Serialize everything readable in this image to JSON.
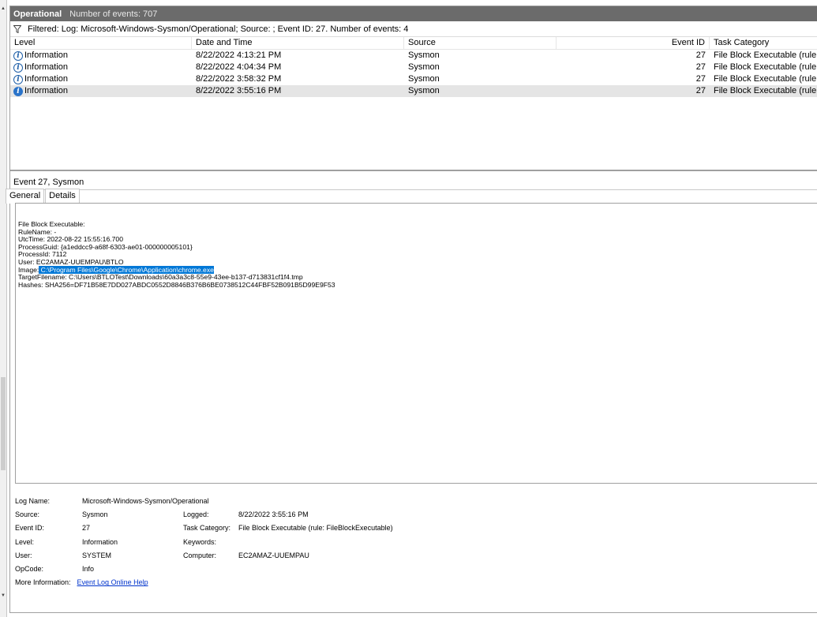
{
  "header": {
    "log_name": "Operational",
    "event_count": "Number of events: 707"
  },
  "filter": {
    "text": "Filtered: Log: Microsoft-Windows-Sysmon/Operational; Source: ; Event ID: 27. Number of events: 4"
  },
  "columns": {
    "level": "Level",
    "date": "Date and Time",
    "source": "Source",
    "eventid": "Event ID",
    "task": "Task Category"
  },
  "rows": [
    {
      "level": "Information",
      "date": "8/22/2022 4:13:21 PM",
      "source": "Sysmon",
      "eventid": "27",
      "task": "File Block Executable (rule: File"
    },
    {
      "level": "Information",
      "date": "8/22/2022 4:04:34 PM",
      "source": "Sysmon",
      "eventid": "27",
      "task": "File Block Executable (rule: File"
    },
    {
      "level": "Information",
      "date": "8/22/2022 3:58:32 PM",
      "source": "Sysmon",
      "eventid": "27",
      "task": "File Block Executable (rule: File"
    },
    {
      "level": "Information",
      "date": "8/22/2022 3:55:16 PM",
      "source": "Sysmon",
      "eventid": "27",
      "task": "File Block Executable (rule: File"
    }
  ],
  "detail": {
    "title": "Event 27, Sysmon",
    "tabs": [
      "General",
      "Details"
    ],
    "lines": {
      "l1": "File Block Executable:",
      "l2": "RuleName: -",
      "l3": "UtcTime: 2022-08-22 15:55:16.700",
      "l4": "ProcessGuid: {a1eddcc9-a68f-6303-ae01-000000005101}",
      "l5": "ProcessId: 7112",
      "l6": "User: EC2AMAZ-UUEMPAU\\BTLO",
      "l7_label": "Image:",
      "l7_value": " C:\\Program Files\\Google\\Chrome\\Application\\chrome.exe",
      "l8": "TargetFilename: C:\\Users\\BTLOTest\\Downloads\\60a3a3c8-55e9-43ee-b137-d713831cf1f4.tmp",
      "l9": "Hashes: SHA256=DF71B58E7DD027ABDC0552D8846B376B6BE0738512C44FBF52B091B5D99E9F53"
    }
  },
  "properties": {
    "log_name_label": "Log Name:",
    "log_name_value": "Microsoft-Windows-Sysmon/Operational",
    "source_label": "Source:",
    "source_value": "Sysmon",
    "logged_label": "Logged:",
    "logged_value": "8/22/2022 3:55:16 PM",
    "eventid_label": "Event ID:",
    "eventid_value": "27",
    "taskcat_label": "Task Category:",
    "taskcat_value": "File Block Executable (rule: FileBlockExecutable)",
    "level_label": "Level:",
    "level_value": "Information",
    "keywords_label": "Keywords:",
    "keywords_value": "",
    "user_label": "User:",
    "user_value": "SYSTEM",
    "computer_label": "Computer:",
    "computer_value": "EC2AMAZ-UUEMPAU",
    "opcode_label": "OpCode:",
    "opcode_value": "Info",
    "moreinfo_label": "More Information:",
    "moreinfo_link": "Event Log Online Help"
  }
}
